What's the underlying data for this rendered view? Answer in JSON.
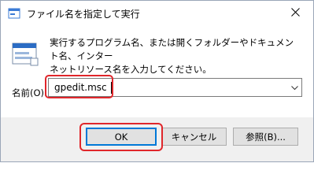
{
  "window": {
    "title": "ファイル名を指定して実行",
    "close_icon": "close-icon"
  },
  "dialog": {
    "description_line1": "実行するプログラム名、または開くフォルダーやドキュメント名、インター",
    "description_line2": "ネットリソース名を入力してください。",
    "open_label": "名前(O):",
    "command_value": "gpedit.msc",
    "run_icon": "run-dialog-icon"
  },
  "buttons": {
    "ok": "OK",
    "cancel": "キャンセル",
    "browse": "参照(B)..."
  },
  "highlight_color": "#e0262b",
  "focus_color": "#0078d7"
}
